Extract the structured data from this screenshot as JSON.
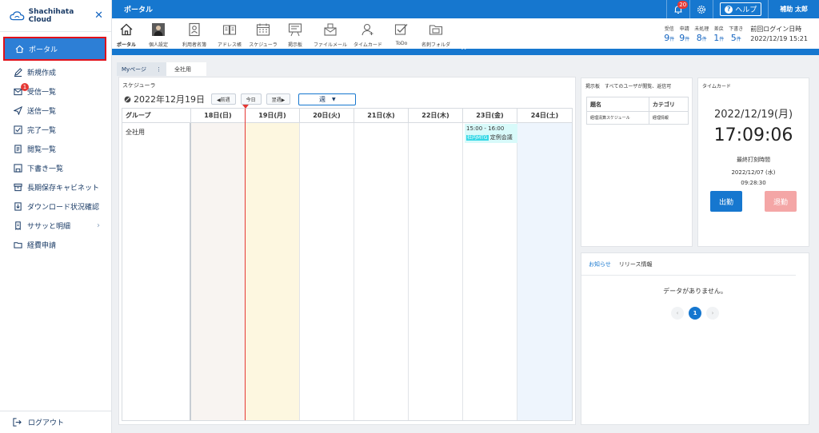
{
  "brand": {
    "name": "Shachihata Cloud"
  },
  "sidebar": {
    "items": [
      {
        "label": "ポータル",
        "icon": "home-icon"
      },
      {
        "label": "新規作成",
        "icon": "pen-icon"
      },
      {
        "label": "受信一覧",
        "icon": "inbox-icon",
        "badge": "1"
      },
      {
        "label": "送信一覧",
        "icon": "send-icon"
      },
      {
        "label": "完了一覧",
        "icon": "check-icon"
      },
      {
        "label": "閲覧一覧",
        "icon": "document-icon"
      },
      {
        "label": "下書き一覧",
        "icon": "draft-icon"
      },
      {
        "label": "長期保存キャビネット",
        "icon": "cabinet-icon"
      },
      {
        "label": "ダウンロード状況確認",
        "icon": "download-icon"
      },
      {
        "label": "ササッと明細",
        "icon": "receipt-icon"
      },
      {
        "label": "経費申請",
        "icon": "folder-icon"
      }
    ],
    "logout": "ログアウト"
  },
  "topbar": {
    "title": "ポータル",
    "notification_count": "20",
    "help": "ヘルプ",
    "user": "補助 太郎"
  },
  "toolbar": {
    "tools": [
      {
        "label": "ポータル",
        "icon": "home-icon"
      },
      {
        "label": "個人設定",
        "icon": "avatar-icon"
      },
      {
        "label": "利用者名簿",
        "icon": "directory-icon"
      },
      {
        "label": "アドレス帳",
        "icon": "address-book-icon"
      },
      {
        "label": "スケジューラ",
        "icon": "calendar-icon"
      },
      {
        "label": "掲示板",
        "icon": "bulletin-board-icon"
      },
      {
        "label": "ファイルメール",
        "icon": "file-mail-icon"
      },
      {
        "label": "タイムカード",
        "icon": "time-card-icon"
      },
      {
        "label": "ToDo",
        "icon": "todo-icon"
      },
      {
        "label": "名刺フォルダ",
        "icon": "business-card-icon"
      }
    ],
    "counters": [
      {
        "label": "受信",
        "value": "9",
        "unit": "件"
      },
      {
        "label": "申請",
        "value": "9",
        "unit": "件"
      },
      {
        "label": "未処理",
        "value": "8",
        "unit": "件"
      },
      {
        "label": "差戻",
        "value": "1",
        "unit": "件"
      },
      {
        "label": "下書き",
        "value": "5",
        "unit": "件"
      }
    ],
    "last_login_label": "前回ログイン日時",
    "last_login": "2022/12/19 15:21"
  },
  "tabs": {
    "my_page": "Myページ",
    "all": "全社用"
  },
  "scheduler": {
    "title": "スケジューラ",
    "date": "2022年12月19日",
    "prev": "◀前週",
    "today": "今日",
    "next": "翌週▶",
    "view": "週",
    "group_header": "グループ",
    "days": [
      "18日(日)",
      "19日(月)",
      "20日(火)",
      "21日(水)",
      "22日(木)",
      "23日(金)",
      "24日(土)"
    ],
    "group_name": "全社用",
    "event": {
      "time": "15:00 - 16:00",
      "tag": "社内MTG",
      "title": "定例会議"
    }
  },
  "board": {
    "title": "掲示板　すべてのユーザが閲覧、返信可",
    "headers": [
      "題名",
      "カテゴリ"
    ],
    "rows": [
      [
        "経理清算スケジュール",
        "経理情報"
      ]
    ]
  },
  "timecard": {
    "title": "タイムカード",
    "date": "2022/12/19(月)",
    "time": "17:09:06",
    "last_label": "最終打刻時間",
    "last_date": "2022/12/07 (水)",
    "last_time": "09:28:30",
    "clock_in": "出勤",
    "clock_out": "退勤"
  },
  "notice": {
    "tab_notice": "お知らせ",
    "tab_release": "リリース情報",
    "empty": "データがありません。",
    "page": "1"
  },
  "colors": {
    "primary": "#1677cf",
    "highlight": "#e0101a"
  }
}
